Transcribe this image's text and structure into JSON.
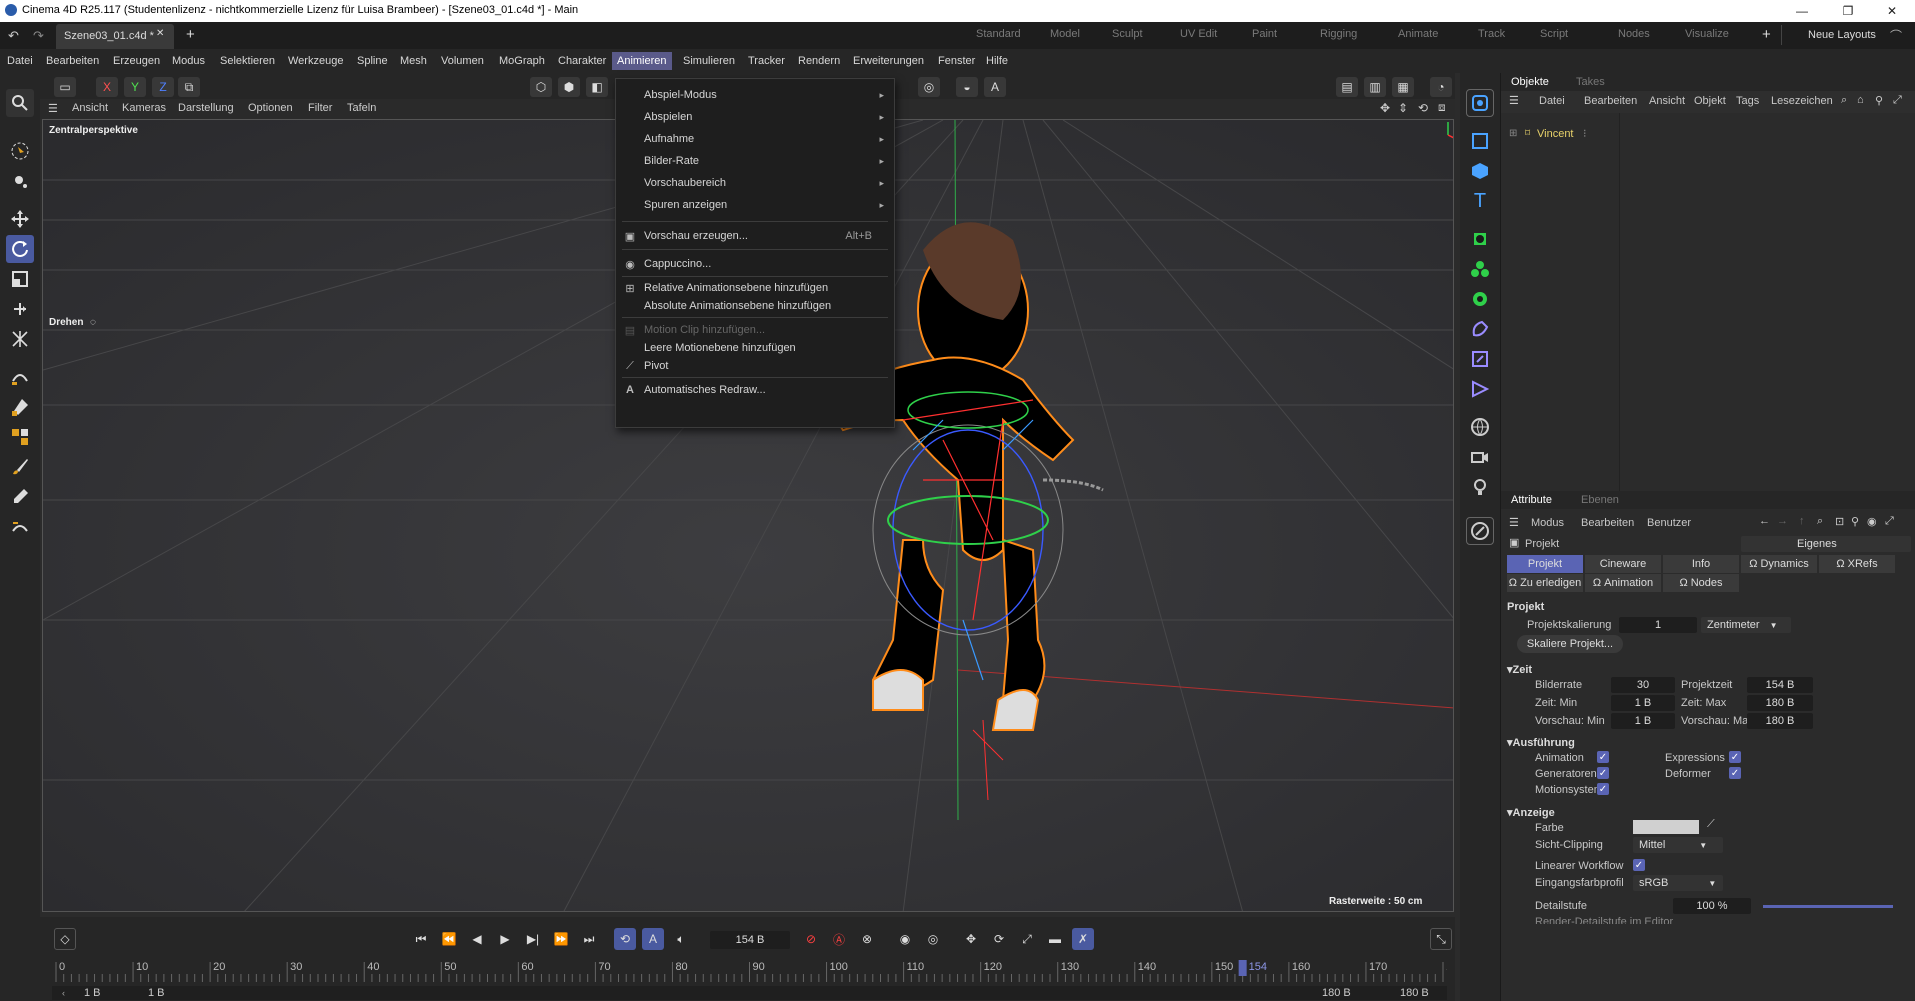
{
  "window": {
    "title": "Cinema 4D R25.117 (Studentenlizenz - nichtkommerzielle Lizenz für Luisa Brambeer) - [Szene03_01.c4d *] - Main",
    "min": "—",
    "max": "❐",
    "close": "✕"
  },
  "tabs": {
    "doc": "Szene03_01.c4d *",
    "add": "+"
  },
  "layouts": [
    "Standard",
    "Model",
    "Sculpt",
    "UV Edit",
    "Paint",
    "Rigging",
    "Animate",
    "Track",
    "Script",
    "Nodes",
    "Visualize"
  ],
  "layout_plus": "+",
  "layout_label": "Neue Layouts",
  "menu": [
    "Datei",
    "Bearbeiten",
    "Erzeugen",
    "Modus",
    "Selektieren",
    "Werkzeuge",
    "Spline",
    "Mesh",
    "Volumen",
    "MoGraph",
    "Charakter",
    "Animieren",
    "Simulieren",
    "Tracker",
    "Rendern",
    "Erweiterungen",
    "Fenster",
    "Hilfe"
  ],
  "axis_buttons": [
    "X",
    "Y",
    "Z"
  ],
  "viewport_menu": [
    "Ansicht",
    "Kameras",
    "Darstellung",
    "Optionen",
    "Filter",
    "Tafeln"
  ],
  "viewport": {
    "camera": "Zentralperspektive",
    "tool": "Drehen",
    "grid": "Rasterweite : 50 cm"
  },
  "dropdown": {
    "group1": [
      {
        "label": "Abspiel-Modus",
        "sub": "▸"
      },
      {
        "label": "Abspielen",
        "sub": "▸"
      },
      {
        "label": "Aufnahme",
        "sub": "▸"
      },
      {
        "label": "Bilder-Rate",
        "sub": "▸"
      },
      {
        "label": "Vorschaubereich",
        "sub": "▸"
      },
      {
        "label": "Spuren anzeigen",
        "sub": "▸"
      }
    ],
    "preview": {
      "label": "Vorschau erzeugen...",
      "shortcut": "Alt+B"
    },
    "cappuccino": "Cappuccino...",
    "rel": "Relative Animationsebene hinzufügen",
    "abs": "Absolute Animationsebene hinzufügen",
    "motion_clip": "Motion Clip hinzufügen...",
    "empty_motion": "Leere Motionebene hinzufügen",
    "pivot": "Pivot",
    "redraw": "Automatisches Redraw..."
  },
  "timeline": {
    "frame": "154 B",
    "ticks": [
      "0",
      "10",
      "20",
      "30",
      "40",
      "50",
      "60",
      "70",
      "80",
      "90",
      "100",
      "110",
      "120",
      "130",
      "140",
      "150",
      "154",
      "160",
      "170",
      "180"
    ],
    "start": "1 B",
    "start2": "1 B",
    "end": "180 B",
    "end2": "180 B",
    "playhead": 154,
    "max": 180
  },
  "objects": {
    "tabs": [
      "Objekte",
      "Takes"
    ],
    "menu": [
      "Datei",
      "Bearbeiten",
      "Ansicht",
      "Objekt",
      "Tags",
      "Lesezeichen"
    ],
    "items": [
      "Vincent"
    ]
  },
  "attributes": {
    "tabs": [
      "Attribute",
      "Ebenen"
    ],
    "menu": [
      "Modus",
      "Bearbeiten",
      "Benutzer"
    ],
    "context": "Projekt",
    "preset": "Eigenes",
    "subtabs": [
      "Projekt",
      "Cineware",
      "Info",
      "Dynamics",
      "XRefs"
    ],
    "subtabs2": [
      "Zu erledigen",
      "Animation",
      "Nodes"
    ],
    "section": "Projekt",
    "scale_label": "Projektskalierung",
    "scale_value": "1",
    "scale_unit": "Zentimeter",
    "scale_button": "Skaliere Projekt...",
    "zeit": "Zeit",
    "fps_label": "Bilderrate",
    "fps": "30",
    "ptime_label": "Projektzeit",
    "ptime": "154 B",
    "tmin_label": "Zeit: Min",
    "tmin": "1 B",
    "tmax_label": "Zeit: Max",
    "tmax": "180 B",
    "vmin_label": "Vorschau: Min",
    "vmin": "1 B",
    "vmax_label": "Vorschau: Max",
    "vmax": "180 B",
    "ausf": "Ausführung",
    "checks": [
      "Animation",
      "Expressions",
      "Generatoren",
      "Deformer",
      "Motionsystem"
    ],
    "anzeige": "Anzeige",
    "farbe": "Farbe",
    "clip_label": "Sicht-Clipping",
    "clip": "Mittel",
    "linear": "Linearer Workflow",
    "profile_label": "Eingangsfarbprofil",
    "profile": "sRGB",
    "detail_label": "Detailstufe",
    "detail": "100 %",
    "cut": "Render-Detailstufe im Editor"
  },
  "colors": {
    "accent": "#5a64b4",
    "menu_active": "#5a5a8a",
    "orange": "#ff8c1a",
    "name_yellow": "#e8d26a"
  }
}
